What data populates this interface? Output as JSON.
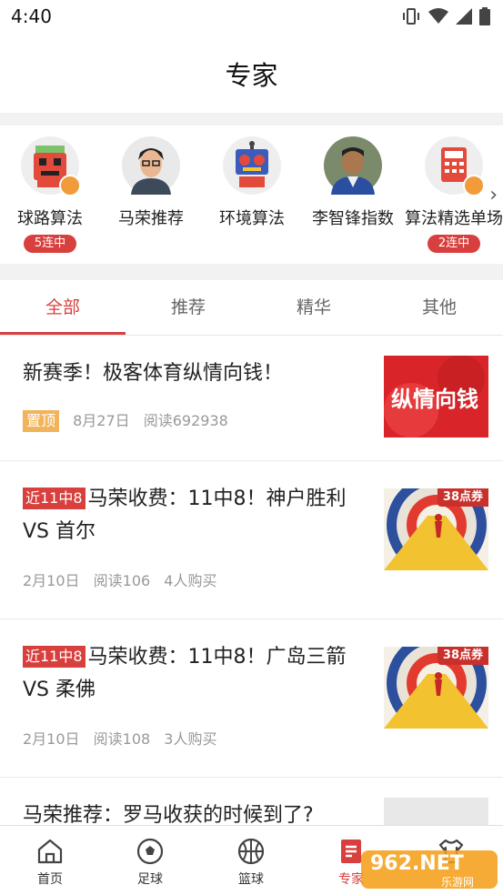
{
  "status_bar": {
    "time": "4:40"
  },
  "header": {
    "title": "专家"
  },
  "experts": [
    {
      "name": "球路算法",
      "badge": "5连中",
      "avatar_icon": "robot-avatar-icon"
    },
    {
      "name": "马荣推荐",
      "badge": "",
      "avatar_icon": "person-avatar"
    },
    {
      "name": "环境算法",
      "badge": "",
      "avatar_icon": "robot-avatar-icon"
    },
    {
      "name": "李智锋指数",
      "badge": "",
      "avatar_icon": "person-avatar"
    },
    {
      "name": "算法精选单场",
      "badge": "2连中",
      "avatar_icon": "calculator-avatar-icon"
    }
  ],
  "tabs": [
    {
      "label": "全部",
      "active": true
    },
    {
      "label": "推荐",
      "active": false
    },
    {
      "label": "精华",
      "active": false
    },
    {
      "label": "其他",
      "active": false
    }
  ],
  "articles": [
    {
      "title": "新赛季！极客体育纵情向钱！",
      "pin": "置顶",
      "date": "8月27日",
      "reads": "阅读692938",
      "thumb_text": "纵情向钱"
    },
    {
      "badge": "近11中8",
      "title": "马荣收费：11中8！神户胜利VS 首尔",
      "date": "2月10日",
      "reads": "阅读106",
      "buyers": "4人购买",
      "coupon": "38点券"
    },
    {
      "badge": "近11中8",
      "title": "马荣收费：11中8！广岛三箭 VS 柔佛",
      "date": "2月10日",
      "reads": "阅读108",
      "buyers": "3人购买",
      "coupon": "38点券"
    },
    {
      "title": "马荣推荐：罗马收获的时候到了?"
    }
  ],
  "bottom_nav": [
    {
      "label": "首页",
      "icon": "home-icon",
      "active": false
    },
    {
      "label": "足球",
      "icon": "football-icon",
      "active": false
    },
    {
      "label": "篮球",
      "icon": "basketball-icon",
      "active": false
    },
    {
      "label": "专家",
      "icon": "expert-icon",
      "active": true
    },
    {
      "label": "",
      "icon": "shirt-icon",
      "active": false
    }
  ],
  "watermark": {
    "text": "962.NET",
    "sub": "乐游网"
  },
  "colors": {
    "accent": "#d8403e",
    "pin": "#f2b45a",
    "bg_band": "#f2f2f2"
  }
}
